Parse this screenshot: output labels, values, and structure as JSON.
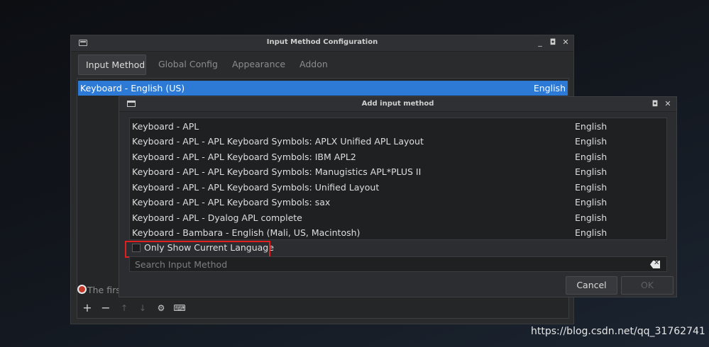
{
  "main_window": {
    "title": "Input Method Configuration",
    "tabs": [
      {
        "label": "Input Method"
      },
      {
        "label": "Global Config"
      },
      {
        "label": "Appearance"
      },
      {
        "label": "Addon"
      }
    ],
    "active_tab": "Input Method",
    "selected_item": {
      "name": "Keyboard - English (US)",
      "language": "English"
    },
    "status_text": "The first"
  },
  "dialog": {
    "title": "Add input method",
    "items": [
      {
        "name": "Keyboard - APL",
        "language": "English"
      },
      {
        "name": "Keyboard - APL - APL Keyboard Symbols: APLX Unified APL Layout",
        "language": "English"
      },
      {
        "name": "Keyboard - APL - APL Keyboard Symbols: IBM APL2",
        "language": "English"
      },
      {
        "name": "Keyboard - APL - APL Keyboard Symbols: Manugistics APL*PLUS II",
        "language": "English"
      },
      {
        "name": "Keyboard - APL - APL Keyboard Symbols: Unified Layout",
        "language": "English"
      },
      {
        "name": "Keyboard - APL - APL Keyboard Symbols: sax",
        "language": "English"
      },
      {
        "name": "Keyboard - APL - Dyalog APL complete",
        "language": "English"
      },
      {
        "name": "Keyboard - Bambara - English (Mali, US, Macintosh)",
        "language": "English"
      }
    ],
    "only_show_current_language": {
      "label": "Only Show Current Language",
      "checked": false
    },
    "search": {
      "placeholder": "Search Input Method",
      "value": ""
    },
    "cancel_label": "Cancel",
    "ok_label": "OK"
  },
  "watermark": "https://blog.csdn.net/qq_31762741",
  "colors": {
    "selection": "#2c7ad6",
    "highlight_box": "#e02020"
  }
}
